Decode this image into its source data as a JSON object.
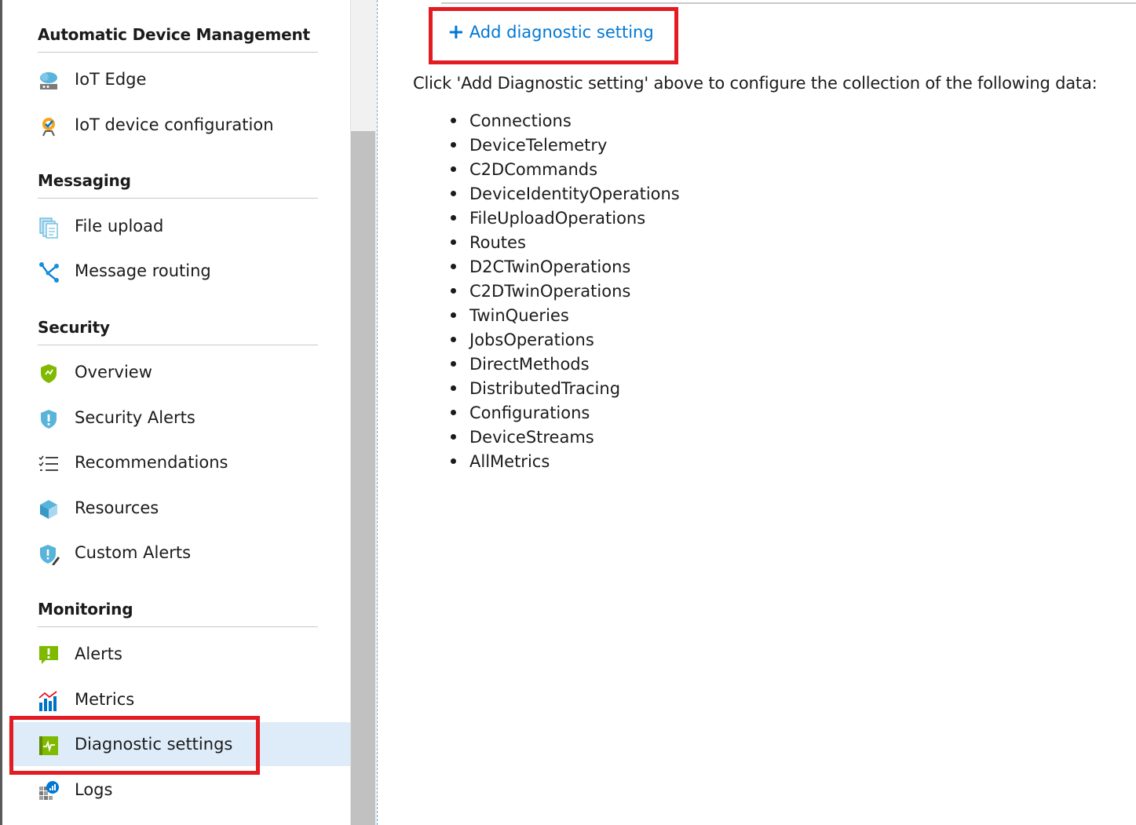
{
  "sidebar": {
    "sections": [
      {
        "title": "Automatic Device Management",
        "items": [
          {
            "label": "IoT Edge",
            "icon": "iot-edge-icon"
          },
          {
            "label": "IoT device configuration",
            "icon": "device-configuration-icon"
          }
        ]
      },
      {
        "title": "Messaging",
        "items": [
          {
            "label": "File upload",
            "icon": "file-upload-icon"
          },
          {
            "label": "Message routing",
            "icon": "message-routing-icon"
          }
        ]
      },
      {
        "title": "Security",
        "items": [
          {
            "label": "Overview",
            "icon": "security-overview-icon"
          },
          {
            "label": "Security Alerts",
            "icon": "security-alerts-icon"
          },
          {
            "label": "Recommendations",
            "icon": "recommendations-icon"
          },
          {
            "label": "Resources",
            "icon": "resources-icon"
          },
          {
            "label": "Custom Alerts",
            "icon": "custom-alerts-icon"
          }
        ]
      },
      {
        "title": "Monitoring",
        "items": [
          {
            "label": "Alerts",
            "icon": "alerts-icon"
          },
          {
            "label": "Metrics",
            "icon": "metrics-icon"
          },
          {
            "label": "Diagnostic settings",
            "icon": "diagnostic-settings-icon",
            "selected": true
          },
          {
            "label": "Logs",
            "icon": "logs-icon"
          }
        ]
      }
    ]
  },
  "main": {
    "add_button_label": "Add diagnostic setting",
    "intro_text": "Click 'Add Diagnostic setting' above to configure the collection of the following data:",
    "data_categories": [
      "Connections",
      "DeviceTelemetry",
      "C2DCommands",
      "DeviceIdentityOperations",
      "FileUploadOperations",
      "Routes",
      "D2CTwinOperations",
      "C2DTwinOperations",
      "TwinQueries",
      "JobsOperations",
      "DirectMethods",
      "DistributedTracing",
      "Configurations",
      "DeviceStreams",
      "AllMetrics"
    ]
  },
  "colors": {
    "accent": "#0078d4",
    "highlight": "#e31b23",
    "selected_bg": "#deecf9"
  }
}
